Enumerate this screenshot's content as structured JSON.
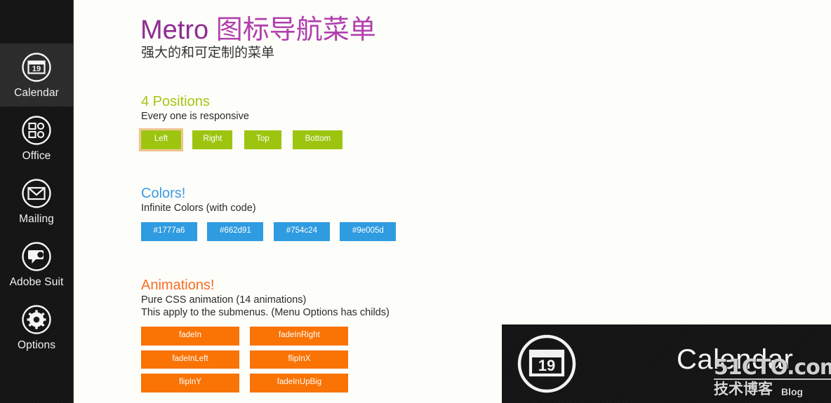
{
  "sidebar": {
    "items": [
      {
        "id": "calendar",
        "label": "Calendar",
        "icon": "calendar-icon",
        "active": true
      },
      {
        "id": "office",
        "label": "Office",
        "icon": "office-grid-icon",
        "active": false
      },
      {
        "id": "mailing",
        "label": "Mailing",
        "icon": "envelope-icon",
        "active": false
      },
      {
        "id": "adobe-suit",
        "label": "Adobe Suit",
        "icon": "speech-bubble-icon",
        "active": false
      },
      {
        "id": "options",
        "label": "Options",
        "icon": "gear-icon",
        "active": false
      }
    ],
    "calendar_icon_day": "19"
  },
  "header": {
    "title_latin": "Metro ",
    "title_cjk": "图标导航菜单",
    "subtitle": "强大的和可定制的菜单",
    "title_color": "#9c2a9c"
  },
  "sections": {
    "positions": {
      "heading": "4 Positions",
      "heading_color": "#a9c312",
      "description": "Every one is responsive",
      "buttons": [
        {
          "label": "Left",
          "focused": true
        },
        {
          "label": "Right",
          "focused": false
        },
        {
          "label": "Top",
          "focused": false
        },
        {
          "label": "Bottom",
          "focused": false
        }
      ],
      "button_color": "#9dc510",
      "focus_ring_color": "#f0c08a"
    },
    "colors": {
      "heading": "Colors!",
      "heading_color": "#3d9ae6",
      "description": "Infinite Colors (with code)",
      "button_color": "#2f9be0",
      "buttons": [
        {
          "label": "#1777a6"
        },
        {
          "label": "#662d91"
        },
        {
          "label": "#754c24"
        },
        {
          "label": "#9e005d"
        }
      ]
    },
    "animations": {
      "heading": "Animations!",
      "heading_color": "#f96d23",
      "description_line1": "Pure CSS animation (14 animations)",
      "description_line2": "This apply to the submenus. (Menu Options has childs)",
      "button_color": "#f97305",
      "buttons": [
        {
          "label": "fadeIn"
        },
        {
          "label": "fadeInRight"
        },
        {
          "label": "fadeInLeft"
        },
        {
          "label": "flipInX"
        },
        {
          "label": "flipInY"
        },
        {
          "label": "fadeInUpBig"
        }
      ]
    }
  },
  "watermark_panel": {
    "calendar_label": "Calendar",
    "calendar_icon_day": "19",
    "brand_main": "51CTO.com",
    "brand_cn": "技术博客",
    "brand_blog": "Blog"
  }
}
